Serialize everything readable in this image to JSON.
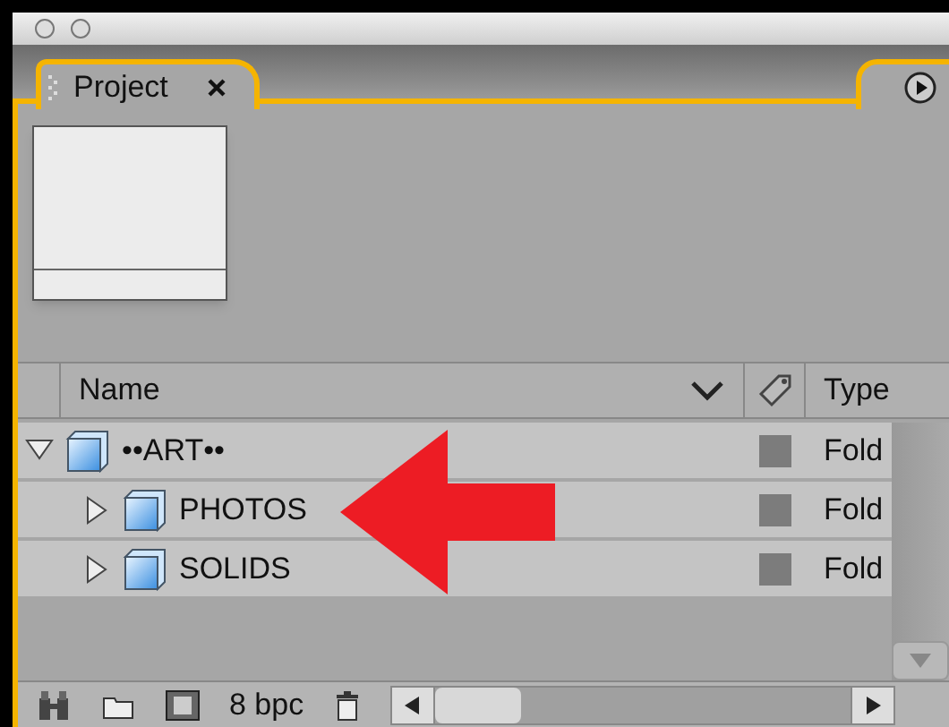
{
  "tabs": [
    {
      "label": "Project",
      "selected": true
    }
  ],
  "columns": [
    "Name",
    "Type"
  ],
  "items": [
    {
      "name": "••ART••",
      "type": "Fold",
      "expanded": true,
      "children": [
        {
          "name": "PHOTOS",
          "type": "Fold",
          "expanded": false
        },
        {
          "name": "SOLIDS",
          "type": "Fold",
          "expanded": false
        }
      ]
    }
  ],
  "status_bar": {
    "bit_depth": "8 bpc"
  }
}
